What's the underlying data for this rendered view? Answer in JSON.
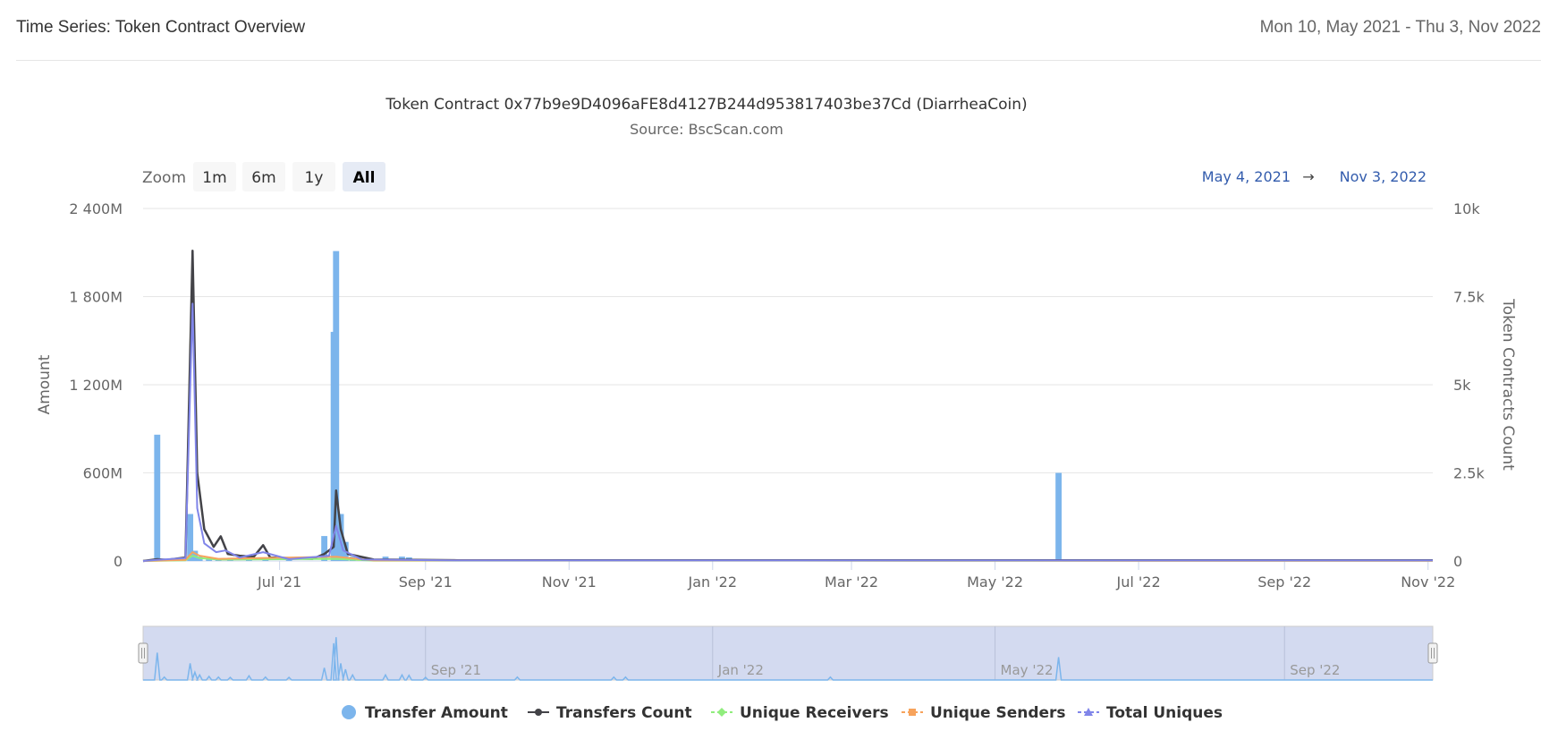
{
  "header": {
    "title": "Time Series: Token Contract Overview",
    "date_range": "Mon 10, May 2021 - Thu 3, Nov 2022"
  },
  "chart": {
    "title": "Token Contract 0x77b9e9D4096aFE8d4127B244d953817403be37Cd (DiarrheaCoin)",
    "subtitle": "Source: BscScan.com",
    "zoom_label": "Zoom",
    "zoom_buttons": [
      "1m",
      "6m",
      "1y",
      "All"
    ],
    "zoom_selected": "All",
    "range_from": "May 4, 2021",
    "range_arrow": "→",
    "range_to": "Nov 3, 2022",
    "colors": {
      "transfer_amount": "#7cb5ec",
      "transfers_count": "#434348",
      "unique_receivers": "#90ed7d",
      "unique_senders": "#f7a35c",
      "total_uniques": "#8085e9",
      "navigator_fill": "#d3daf0",
      "range_text": "#335cad"
    }
  },
  "chart_data": {
    "type": "bar",
    "x_axis": {
      "type": "datetime",
      "range": [
        "2021-05-04",
        "2022-11-03"
      ],
      "tick_labels": [
        "Jul '21",
        "Sep '21",
        "Nov '21",
        "Jan '22",
        "Mar '22",
        "May '22",
        "Jul '22",
        "Sep '22",
        "Nov '22"
      ],
      "tick_dates": [
        "2021-07-01",
        "2021-09-01",
        "2021-11-01",
        "2022-01-01",
        "2022-03-01",
        "2022-05-01",
        "2022-07-01",
        "2022-09-01",
        "2022-11-01"
      ]
    },
    "y_axis_left": {
      "label": "Amount",
      "range": [
        0,
        2400000000
      ],
      "tick_labels": [
        "0",
        "600M",
        "1 200M",
        "1 800M",
        "2 400M"
      ],
      "tick_values": [
        0,
        600000000,
        1200000000,
        1800000000,
        2400000000
      ]
    },
    "y_axis_right": {
      "label": "Token Contracts Count",
      "range": [
        0,
        10000
      ],
      "tick_labels": [
        "0",
        "2.5k",
        "5k",
        "7.5k",
        "10k"
      ],
      "tick_values": [
        0,
        2500,
        5000,
        7500,
        10000
      ]
    },
    "grid": true,
    "legend_position": "bottom-center",
    "series": [
      {
        "name": "Transfer Amount",
        "type": "column",
        "axis": "left",
        "points": [
          [
            "2021-05-10",
            860000000
          ],
          [
            "2021-05-13",
            10000000
          ],
          [
            "2021-05-24",
            320000000
          ],
          [
            "2021-05-26",
            70000000
          ],
          [
            "2021-05-28",
            30000000
          ],
          [
            "2021-06-01",
            15000000
          ],
          [
            "2021-06-05",
            10000000
          ],
          [
            "2021-06-10",
            8000000
          ],
          [
            "2021-06-18",
            20000000
          ],
          [
            "2021-06-25",
            10000000
          ],
          [
            "2021-07-05",
            8000000
          ],
          [
            "2021-07-20",
            170000000
          ],
          [
            "2021-07-24",
            1560000000
          ],
          [
            "2021-07-25",
            2110000000
          ],
          [
            "2021-07-27",
            320000000
          ],
          [
            "2021-07-29",
            130000000
          ],
          [
            "2021-08-01",
            30000000
          ],
          [
            "2021-08-15",
            30000000
          ],
          [
            "2021-08-22",
            30000000
          ],
          [
            "2021-08-25",
            25000000
          ],
          [
            "2021-09-01",
            8000000
          ],
          [
            "2021-10-10",
            10000000
          ],
          [
            "2021-11-20",
            10000000
          ],
          [
            "2021-11-25",
            10000000
          ],
          [
            "2022-02-20",
            10000000
          ],
          [
            "2022-05-28",
            600000000
          ]
        ]
      },
      {
        "name": "Transfers Count",
        "type": "line",
        "axis": "right",
        "points": [
          [
            "2021-05-04",
            0
          ],
          [
            "2021-05-10",
            50
          ],
          [
            "2021-05-14",
            30
          ],
          [
            "2021-05-22",
            100
          ],
          [
            "2021-05-25",
            8800
          ],
          [
            "2021-05-27",
            2500
          ],
          [
            "2021-05-30",
            900
          ],
          [
            "2021-06-03",
            400
          ],
          [
            "2021-06-06",
            700
          ],
          [
            "2021-06-09",
            200
          ],
          [
            "2021-06-14",
            150
          ],
          [
            "2021-06-20",
            120
          ],
          [
            "2021-06-24",
            450
          ],
          [
            "2021-06-27",
            100
          ],
          [
            "2021-07-05",
            80
          ],
          [
            "2021-07-15",
            60
          ],
          [
            "2021-07-20",
            200
          ],
          [
            "2021-07-24",
            400
          ],
          [
            "2021-07-25",
            2000
          ],
          [
            "2021-07-27",
            900
          ],
          [
            "2021-07-30",
            200
          ],
          [
            "2021-08-10",
            40
          ],
          [
            "2021-09-15",
            20
          ],
          [
            "2022-11-03",
            20
          ]
        ]
      },
      {
        "name": "Unique Receivers",
        "type": "line",
        "axis": "right",
        "points": [
          [
            "2021-05-04",
            0
          ],
          [
            "2021-05-22",
            20
          ],
          [
            "2021-05-25",
            150
          ],
          [
            "2021-05-28",
            80
          ],
          [
            "2021-06-05",
            40
          ],
          [
            "2021-07-25",
            60
          ],
          [
            "2021-08-10",
            10
          ],
          [
            "2022-11-03",
            5
          ]
        ]
      },
      {
        "name": "Unique Senders",
        "type": "line",
        "axis": "right",
        "points": [
          [
            "2021-05-04",
            0
          ],
          [
            "2021-05-22",
            30
          ],
          [
            "2021-05-25",
            250
          ],
          [
            "2021-05-28",
            150
          ],
          [
            "2021-06-05",
            60
          ],
          [
            "2021-07-25",
            120
          ],
          [
            "2021-08-10",
            15
          ],
          [
            "2022-11-03",
            5
          ]
        ]
      },
      {
        "name": "Total Uniques",
        "type": "line",
        "axis": "right",
        "points": [
          [
            "2021-05-04",
            0
          ],
          [
            "2021-05-10",
            30
          ],
          [
            "2021-05-22",
            80
          ],
          [
            "2021-05-25",
            7300
          ],
          [
            "2021-05-27",
            1500
          ],
          [
            "2021-05-30",
            500
          ],
          [
            "2021-06-04",
            250
          ],
          [
            "2021-06-08",
            300
          ],
          [
            "2021-06-14",
            100
          ],
          [
            "2021-06-24",
            250
          ],
          [
            "2021-07-05",
            50
          ],
          [
            "2021-07-22",
            150
          ],
          [
            "2021-07-25",
            1000
          ],
          [
            "2021-07-28",
            300
          ],
          [
            "2021-08-05",
            40
          ],
          [
            "2021-09-15",
            15
          ],
          [
            "2022-11-03",
            15
          ]
        ]
      }
    ],
    "navigator": {
      "tick_labels": [
        "Sep '21",
        "Jan '22",
        "May '22",
        "Sep '22"
      ],
      "tick_dates": [
        "2021-09-01",
        "2022-01-01",
        "2022-05-01",
        "2022-09-01"
      ],
      "range": [
        "2021-05-04",
        "2022-11-03"
      ]
    }
  }
}
